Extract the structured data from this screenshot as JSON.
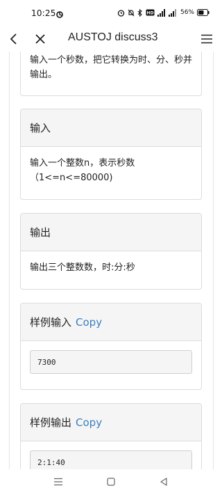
{
  "status_bar": {
    "time": "10:25",
    "battery": "56%",
    "icons": [
      "sync-icon",
      "alarm-icon",
      "silent-icon",
      "bluetooth-icon",
      "hd-icon",
      "signal-icon",
      "signal-icon",
      "battery-icon"
    ]
  },
  "app_bar": {
    "title": "AUSTOJ discuss3",
    "icons": [
      "back-icon",
      "close-icon",
      "menu-icon"
    ]
  },
  "problem": {
    "description_tail": "输入一个秒数，把它转换为时、分、秒并输出。",
    "input": {
      "heading": "输入",
      "text": "输入一个整数n，表示秒数（1<=n<=80000)"
    },
    "output": {
      "heading": "输出",
      "text": "输出三个整数数，时:分:秒"
    },
    "sample_input": {
      "heading": "样例输入",
      "copy_label": "Copy",
      "value": "7300"
    },
    "sample_output": {
      "heading": "样例输出",
      "copy_label": "Copy",
      "value": "2:1:40"
    }
  },
  "nav_bar": {
    "icons": [
      "recents-icon",
      "home-icon",
      "back-triangle-icon"
    ]
  },
  "colors": {
    "link": "#3a7fc1",
    "panel_header": "#f5f5f5",
    "border": "#dcdcdc"
  }
}
